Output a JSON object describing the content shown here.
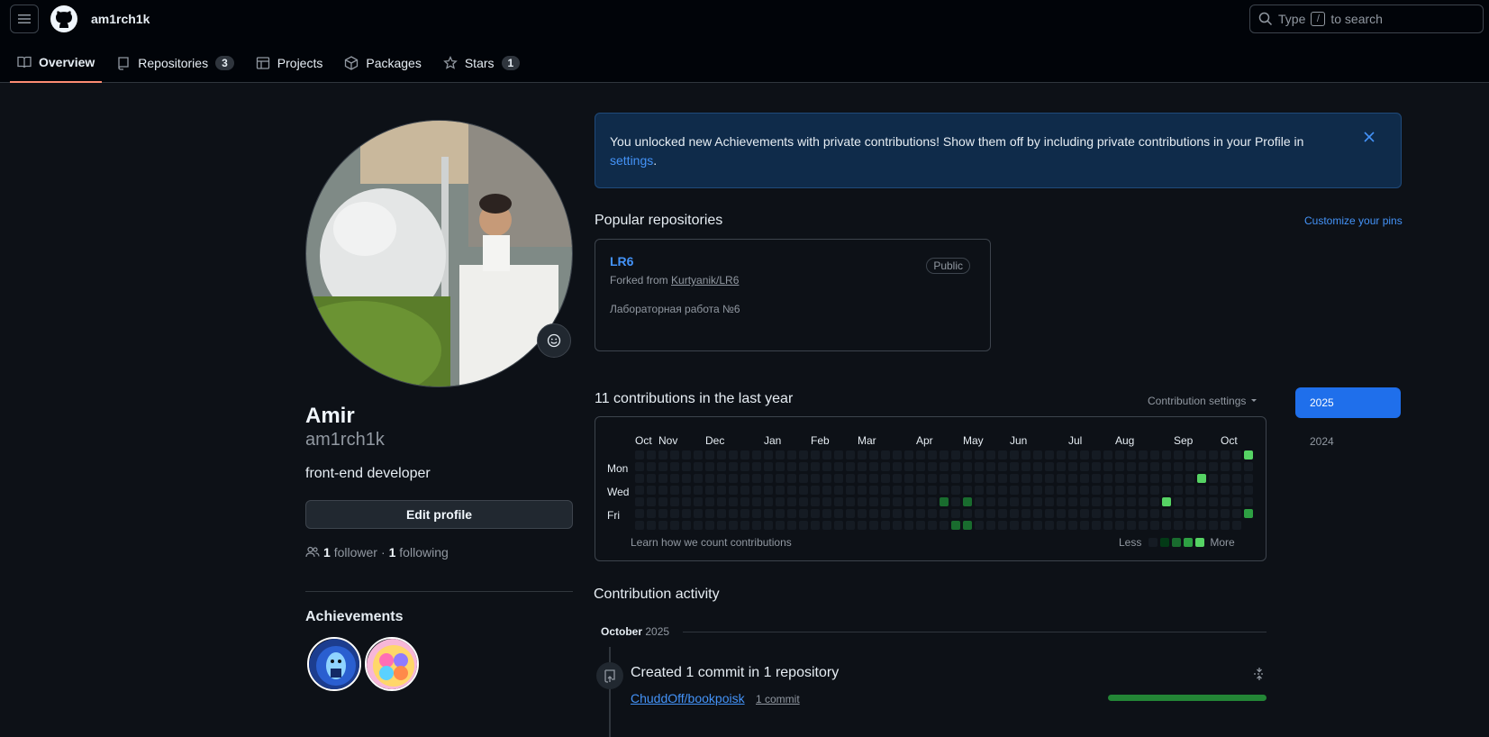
{
  "header": {
    "username": "am1rch1k",
    "search_prefix": "Type",
    "search_key": "/",
    "search_suffix": "to search"
  },
  "tabs": [
    {
      "label": "Overview",
      "active": true
    },
    {
      "label": "Repositories",
      "count": "3"
    },
    {
      "label": "Projects"
    },
    {
      "label": "Packages"
    },
    {
      "label": "Stars",
      "count": "1"
    }
  ],
  "profile": {
    "name": "Amir",
    "login": "am1rch1k",
    "bio": "front-end developer",
    "edit_label": "Edit profile",
    "followers_count": "1",
    "followers_label": "follower",
    "separator": "·",
    "following_count": "1",
    "following_label": "following",
    "achievements_title": "Achievements"
  },
  "flash": {
    "text": "You unlocked new Achievements with private contributions! Show them off by including private contributions in your Profile in",
    "link": "settings",
    "tail": "."
  },
  "popular": {
    "title": "Popular repositories",
    "customize": "Customize your pins",
    "repos": [
      {
        "name": "LR6",
        "visibility": "Public",
        "forked_prefix": "Forked from",
        "forked_from": "Kurtyanik/LR6",
        "description": "Лабораторная работа №6"
      }
    ]
  },
  "contributions": {
    "title": "11 contributions in the last year",
    "settings_label": "Contribution settings",
    "months": [
      "Oct",
      "Nov",
      "Dec",
      "Jan",
      "Feb",
      "Mar",
      "Apr",
      "May",
      "Jun",
      "Jul",
      "Aug",
      "Sep",
      "Oct"
    ],
    "month_week_index": [
      0,
      2,
      6,
      11,
      15,
      19,
      24,
      28,
      32,
      37,
      41,
      46,
      50
    ],
    "days": [
      "Mon",
      "Wed",
      "Fri"
    ],
    "weeks": 53,
    "levels": [
      {
        "week": 26,
        "day": 4,
        "level": 2
      },
      {
        "week": 27,
        "day": 6,
        "level": 2
      },
      {
        "week": 28,
        "day": 4,
        "level": 2
      },
      {
        "week": 28,
        "day": 6,
        "level": 2
      },
      {
        "week": 45,
        "day": 4,
        "level": 4
      },
      {
        "week": 48,
        "day": 2,
        "level": 4
      },
      {
        "week": 52,
        "day": 0,
        "level": 4
      },
      {
        "week": 52,
        "day": 5,
        "level": 3
      }
    ],
    "learn": "Learn how we count contributions",
    "less": "Less",
    "more": "More",
    "level_colors": [
      "#151b23",
      "#033a16",
      "#196c2e",
      "#2ea043",
      "#56d364"
    ],
    "years": [
      "2025",
      "2024"
    ],
    "selected_year": "2025"
  },
  "activity": {
    "title": "Contribution activity",
    "month": "October",
    "year": "2025",
    "summary": "Created 1 commit in 1 repository",
    "repo": "ChuddOff/bookpoisk",
    "commits": "1 commit",
    "commit_share": 1.0
  }
}
